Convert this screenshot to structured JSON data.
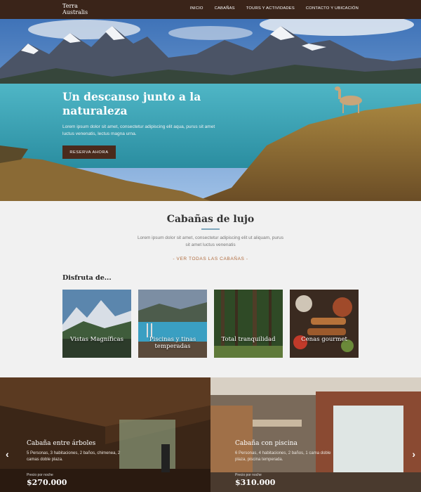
{
  "nav": {
    "logo_line1": "Terra",
    "logo_line2": "Australis",
    "links": [
      "INICIO",
      "CABAÑAS",
      "TOURS Y ACTIVIDADES",
      "CONTACTO Y UBICACIÓN"
    ]
  },
  "hero": {
    "title": "Un descanso junto a la naturaleza",
    "text": "Lorem ipsum dolor sit amet, consectetur adipiscing elit aqua, purus sit amet luctus venenatis, lectus magna urna.",
    "button": "RESERVA AHORA"
  },
  "cabanas": {
    "title": "Cabañas de lujo",
    "text": "Lorem ipsum dolor sit amet, consectetur adipiscing elit ut aliquam, purus sit amet luctus venenatis",
    "link": "- VER TODAS LAS CABAÑAS -"
  },
  "disfruta": {
    "heading": "Disfruta de...",
    "cards": [
      {
        "label": "Vistas Magníficas"
      },
      {
        "label": "Piscinas y tinas temperadas"
      },
      {
        "label": "Total tranquilidad"
      },
      {
        "label": "Cenas gourmet"
      }
    ]
  },
  "slides": [
    {
      "title": "Cabaña entre árboles",
      "desc": "5 Personas, 3 habitaciones, 2 baños, chimenea, 2 camas doble plaza.",
      "price_label": "Precio por noche",
      "price": "$270.000"
    },
    {
      "title": "Cabaña con piscina",
      "desc": "6 Personas, 4 habitaciones, 2 baños, 1 cama doble plaza, piscina temperada.",
      "price_label": "Precio por noche",
      "price": "$310.000"
    }
  ],
  "arrows": {
    "prev": "‹",
    "next": "›"
  }
}
